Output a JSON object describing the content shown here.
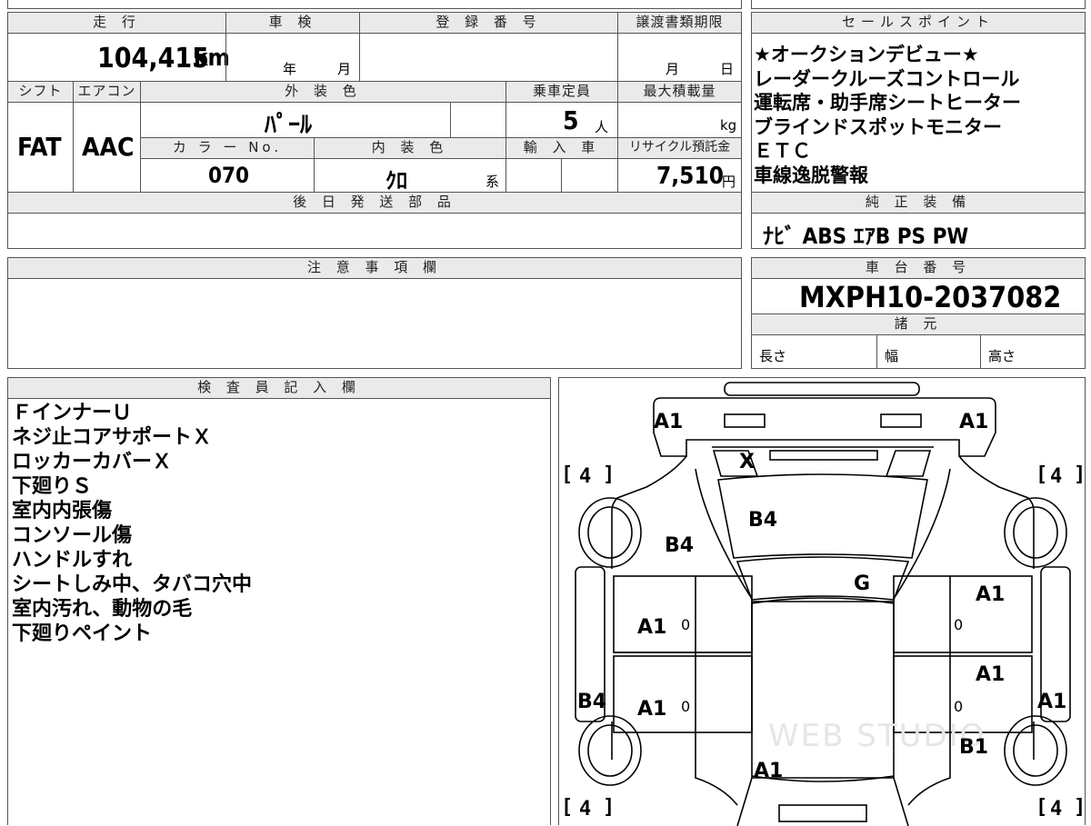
{
  "top_row": {
    "mileage_header": "走 行",
    "mileage_value": "104,415",
    "mileage_unit": "km",
    "inspection_header": "車 検",
    "inspection_year": "年",
    "inspection_month": "月",
    "reg_header": "登 録 番 号",
    "transfer_header": "譲渡書類期限",
    "transfer_month": "月",
    "transfer_day": "日"
  },
  "second_row": {
    "shift_header": "シフト",
    "ac_header": "エアコン",
    "exterior_header": "外 装 色",
    "capacity_header": "乗車定員",
    "max_load_header": "最大積載量",
    "shift_value": "FAT",
    "ac_value": "AAC",
    "exterior_value": "ﾊﾟｰﾙ",
    "capacity_value": "5",
    "capacity_unit": "人",
    "max_load_unit": "kg",
    "color_no_header": "カ ラ ー No.",
    "interior_header": "内 装 色",
    "import_header": "輸 入 車",
    "recycle_header": "リサイクル預託金",
    "color_no_value": "070",
    "interior_value": "ｸﾛ",
    "interior_suffix": "系",
    "recycle_value": "7,510",
    "recycle_unit": "円"
  },
  "later_parts": {
    "header": "後 日 発 送 部 品"
  },
  "sales_points": {
    "header": "セールスポイント",
    "lines": [
      "★オークションデビュー★",
      "レーダークルーズコントロール",
      "運転席・助手席シートヒーター",
      "ブラインドスポットモニター",
      "ＥＴＣ",
      "車線逸脱警報"
    ]
  },
  "genuine_equipment": {
    "header": "純 正 装 備",
    "value": "ﾅﾋﾞ ABS ｴｱB PS PW"
  },
  "notes": {
    "header": "注 意 事 項 欄"
  },
  "chassis": {
    "header": "車 台 番 号",
    "value": "MXPH10-2037082",
    "spec_header": "諸 元",
    "length_label": "長さ",
    "width_label": "幅",
    "height_label": "高さ"
  },
  "inspector": {
    "header": "検 査 員 記 入 欄",
    "lines": [
      "ＦインナーＵ",
      "ネジ止コアサポートＸ",
      "ロッカーカバーＸ",
      "下廻りＳ",
      "室内内張傷",
      "コンソール傷",
      "ハンドルすれ",
      "シートしみ中、タバコ穴中",
      "室内汚れ、動物の毛",
      "下廻りペイント"
    ]
  },
  "diagram": {
    "labels": {
      "front_left": "A1",
      "front_right": "A1",
      "windshield": "X",
      "hood": "B4",
      "left_front_fender": "B4",
      "roof": "G",
      "right_front_door": "A1",
      "left_front_door": "A1",
      "right_rear_door": "A1",
      "left_rear_door": "A1",
      "left_rocker": "B4",
      "right_rocker": "A1",
      "right_rear_fender": "B1",
      "trunk": "A1",
      "tire_fl": "4",
      "tire_fr": "4",
      "tire_rl": "4",
      "tire_rr": "4",
      "zero_1": "0",
      "zero_2": "0",
      "zero_3": "0",
      "zero_4": "0"
    },
    "watermark": "WEB STUDIO"
  }
}
